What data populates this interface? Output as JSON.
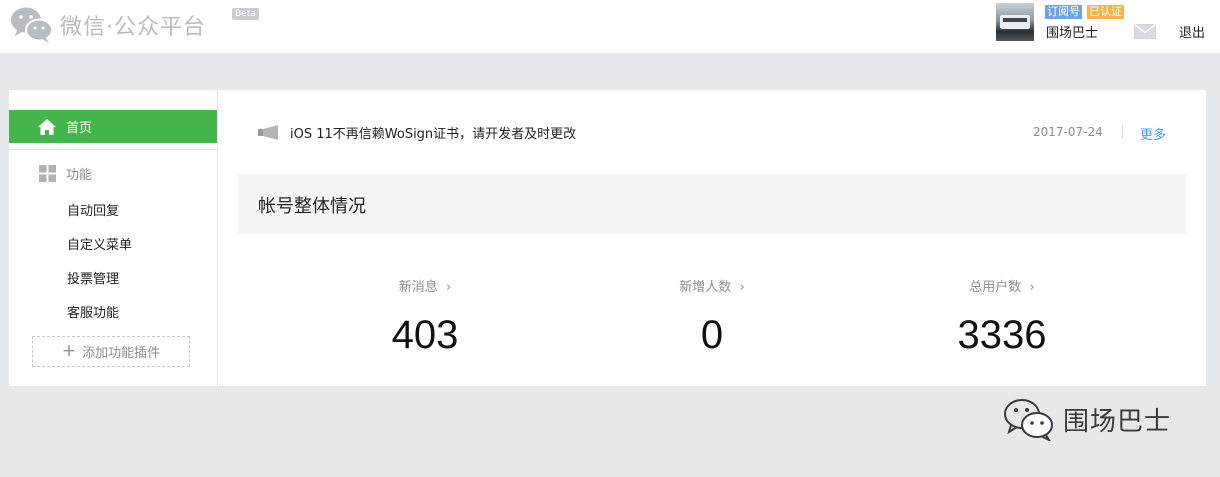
{
  "header": {
    "logo_text": "微信·公众平台",
    "beta": "Beta",
    "badge_subscription": "订阅号",
    "badge_verified": "已认证",
    "username": "围场巴士",
    "logout": "退出"
  },
  "sidebar": {
    "home_label": "首页",
    "section_label": "功能",
    "items": [
      "自动回复",
      "自定义菜单",
      "投票管理",
      "客服功能"
    ],
    "add_plugin": "添加功能插件"
  },
  "notice": {
    "text": "iOS 11不再信赖WoSign证书，请开发者及时更改",
    "date": "2017-07-24",
    "more": "更多"
  },
  "overview": {
    "title": "帐号整体情况",
    "stats": [
      {
        "label": "新消息",
        "value": "403"
      },
      {
        "label": "新增人数",
        "value": "0"
      },
      {
        "label": "总用户数",
        "value": "3336"
      }
    ]
  },
  "watermark": {
    "text": "围场巴士"
  },
  "colors": {
    "accent": "#44b549",
    "link": "#459ae9",
    "badge_blue": "#6aa6e5",
    "badge_orange": "#f3b547"
  },
  "icons": [
    "wechat-logo-icon",
    "home-icon",
    "grid-icon",
    "megaphone-icon",
    "mail-icon",
    "chevron-right-icon",
    "plus-icon"
  ]
}
